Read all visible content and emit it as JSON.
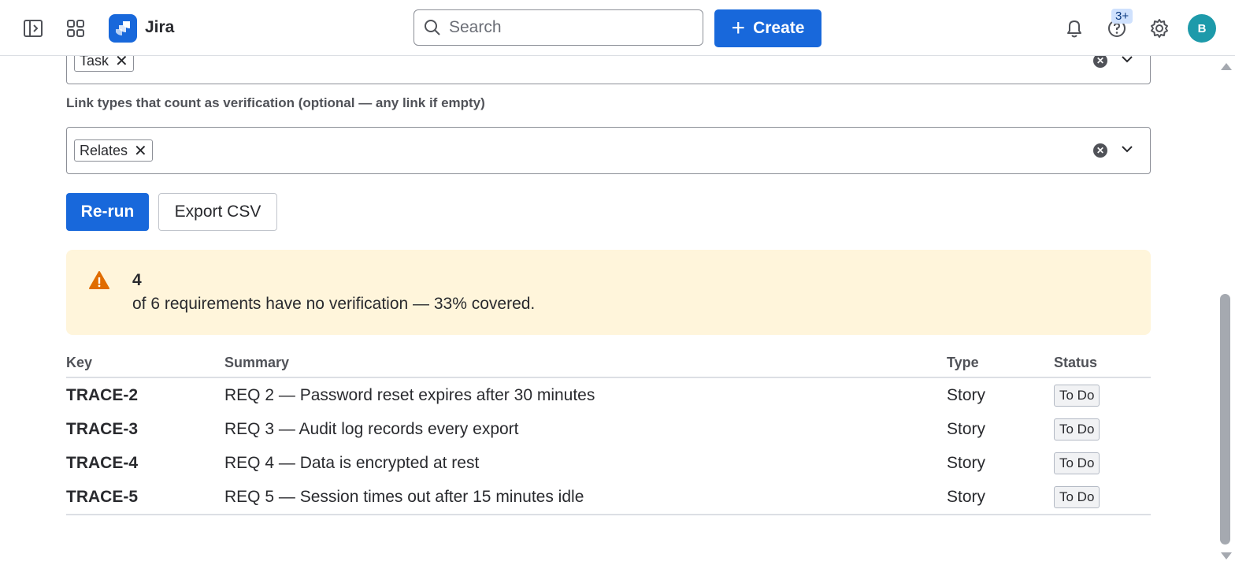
{
  "nav": {
    "app_name": "Jira",
    "search_placeholder": "Search",
    "create_label": "Create",
    "help_badge": "3+",
    "avatar_initial": "B"
  },
  "filters": {
    "issue_type_chip": "Task",
    "link_types_label": "Link types that count as verification (optional — any link if empty)",
    "link_type_chip": "Relates"
  },
  "actions": {
    "rerun_label": "Re-run",
    "export_label": "Export CSV"
  },
  "warning": {
    "count": "4",
    "text": "of 6 requirements have no verification — 33% covered."
  },
  "table": {
    "headers": {
      "key": "Key",
      "summary": "Summary",
      "type": "Type",
      "status": "Status"
    },
    "rows": [
      {
        "key": "TRACE-2",
        "summary": "REQ 2 — Password reset expires after 30 minutes",
        "type": "Story",
        "status": "To Do"
      },
      {
        "key": "TRACE-3",
        "summary": "REQ 3 — Audit log records every export",
        "type": "Story",
        "status": "To Do"
      },
      {
        "key": "TRACE-4",
        "summary": "REQ 4 — Data is encrypted at rest",
        "type": "Story",
        "status": "To Do"
      },
      {
        "key": "TRACE-5",
        "summary": "REQ 5 — Session times out after 15 minutes idle",
        "type": "Story",
        "status": "To Do"
      }
    ]
  },
  "colors": {
    "brand": "#1868db",
    "warning_bg": "#fff5db",
    "warning_icon": "#e06c00"
  }
}
